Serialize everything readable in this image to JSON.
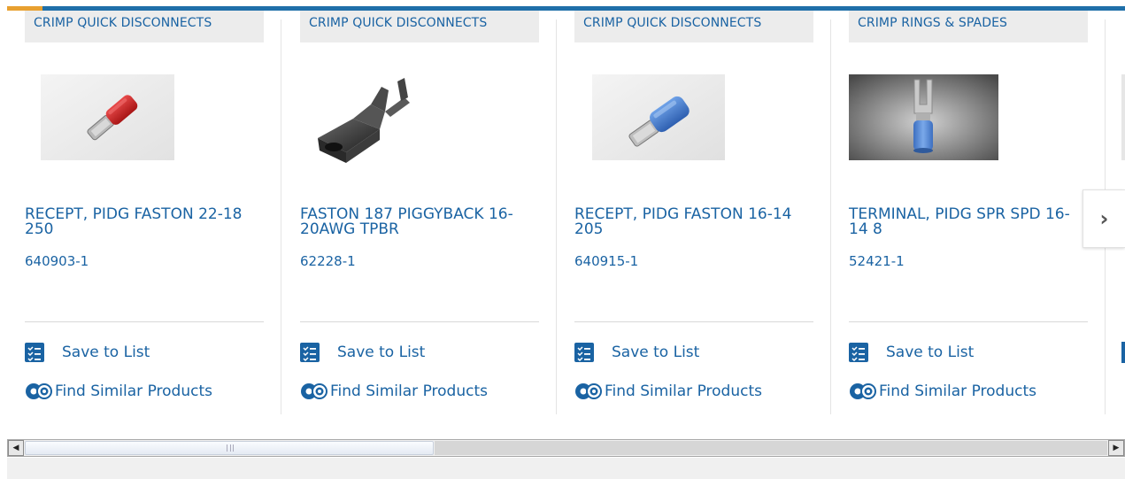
{
  "colors": {
    "accent": "#1a63a3",
    "topbar": "#1f6fa9",
    "topbar_accent": "#e8a030"
  },
  "carousel": {
    "next_icon": "chevron-right-icon",
    "next_glyph": "›",
    "cards": [
      {
        "category": "CRIMP QUICK DISCONNECTS",
        "title": "RECEPT, PIDG FASTON 22-18 250",
        "part_number": "640903-1",
        "save_label": "Save to List",
        "similar_label": "Find Similar Products",
        "image": "red-insulated-receptacle-image"
      },
      {
        "category": "CRIMP QUICK DISCONNECTS",
        "title": "FASTON 187 PIGGYBACK 16-20AWG TPBR",
        "part_number": "62228-1",
        "save_label": "Save to List",
        "similar_label": "Find Similar Products",
        "image": "piggyback-terminal-image"
      },
      {
        "category": "CRIMP QUICK DISCONNECTS",
        "title": "RECEPT, PIDG FASTON 16-14 205",
        "part_number": "640915-1",
        "save_label": "Save to List",
        "similar_label": "Find Similar Products",
        "image": "blue-insulated-receptacle-image"
      },
      {
        "category": "CRIMP RINGS & SPADES",
        "title": "TERMINAL, PIDG SPR SPD 16-14 8",
        "part_number": "52421-1",
        "save_label": "Save to List",
        "similar_label": "Find Similar Products",
        "image": "blue-spade-terminal-image"
      }
    ]
  },
  "scrollbar": {
    "left_glyph": "◀",
    "right_glyph": "▶"
  }
}
